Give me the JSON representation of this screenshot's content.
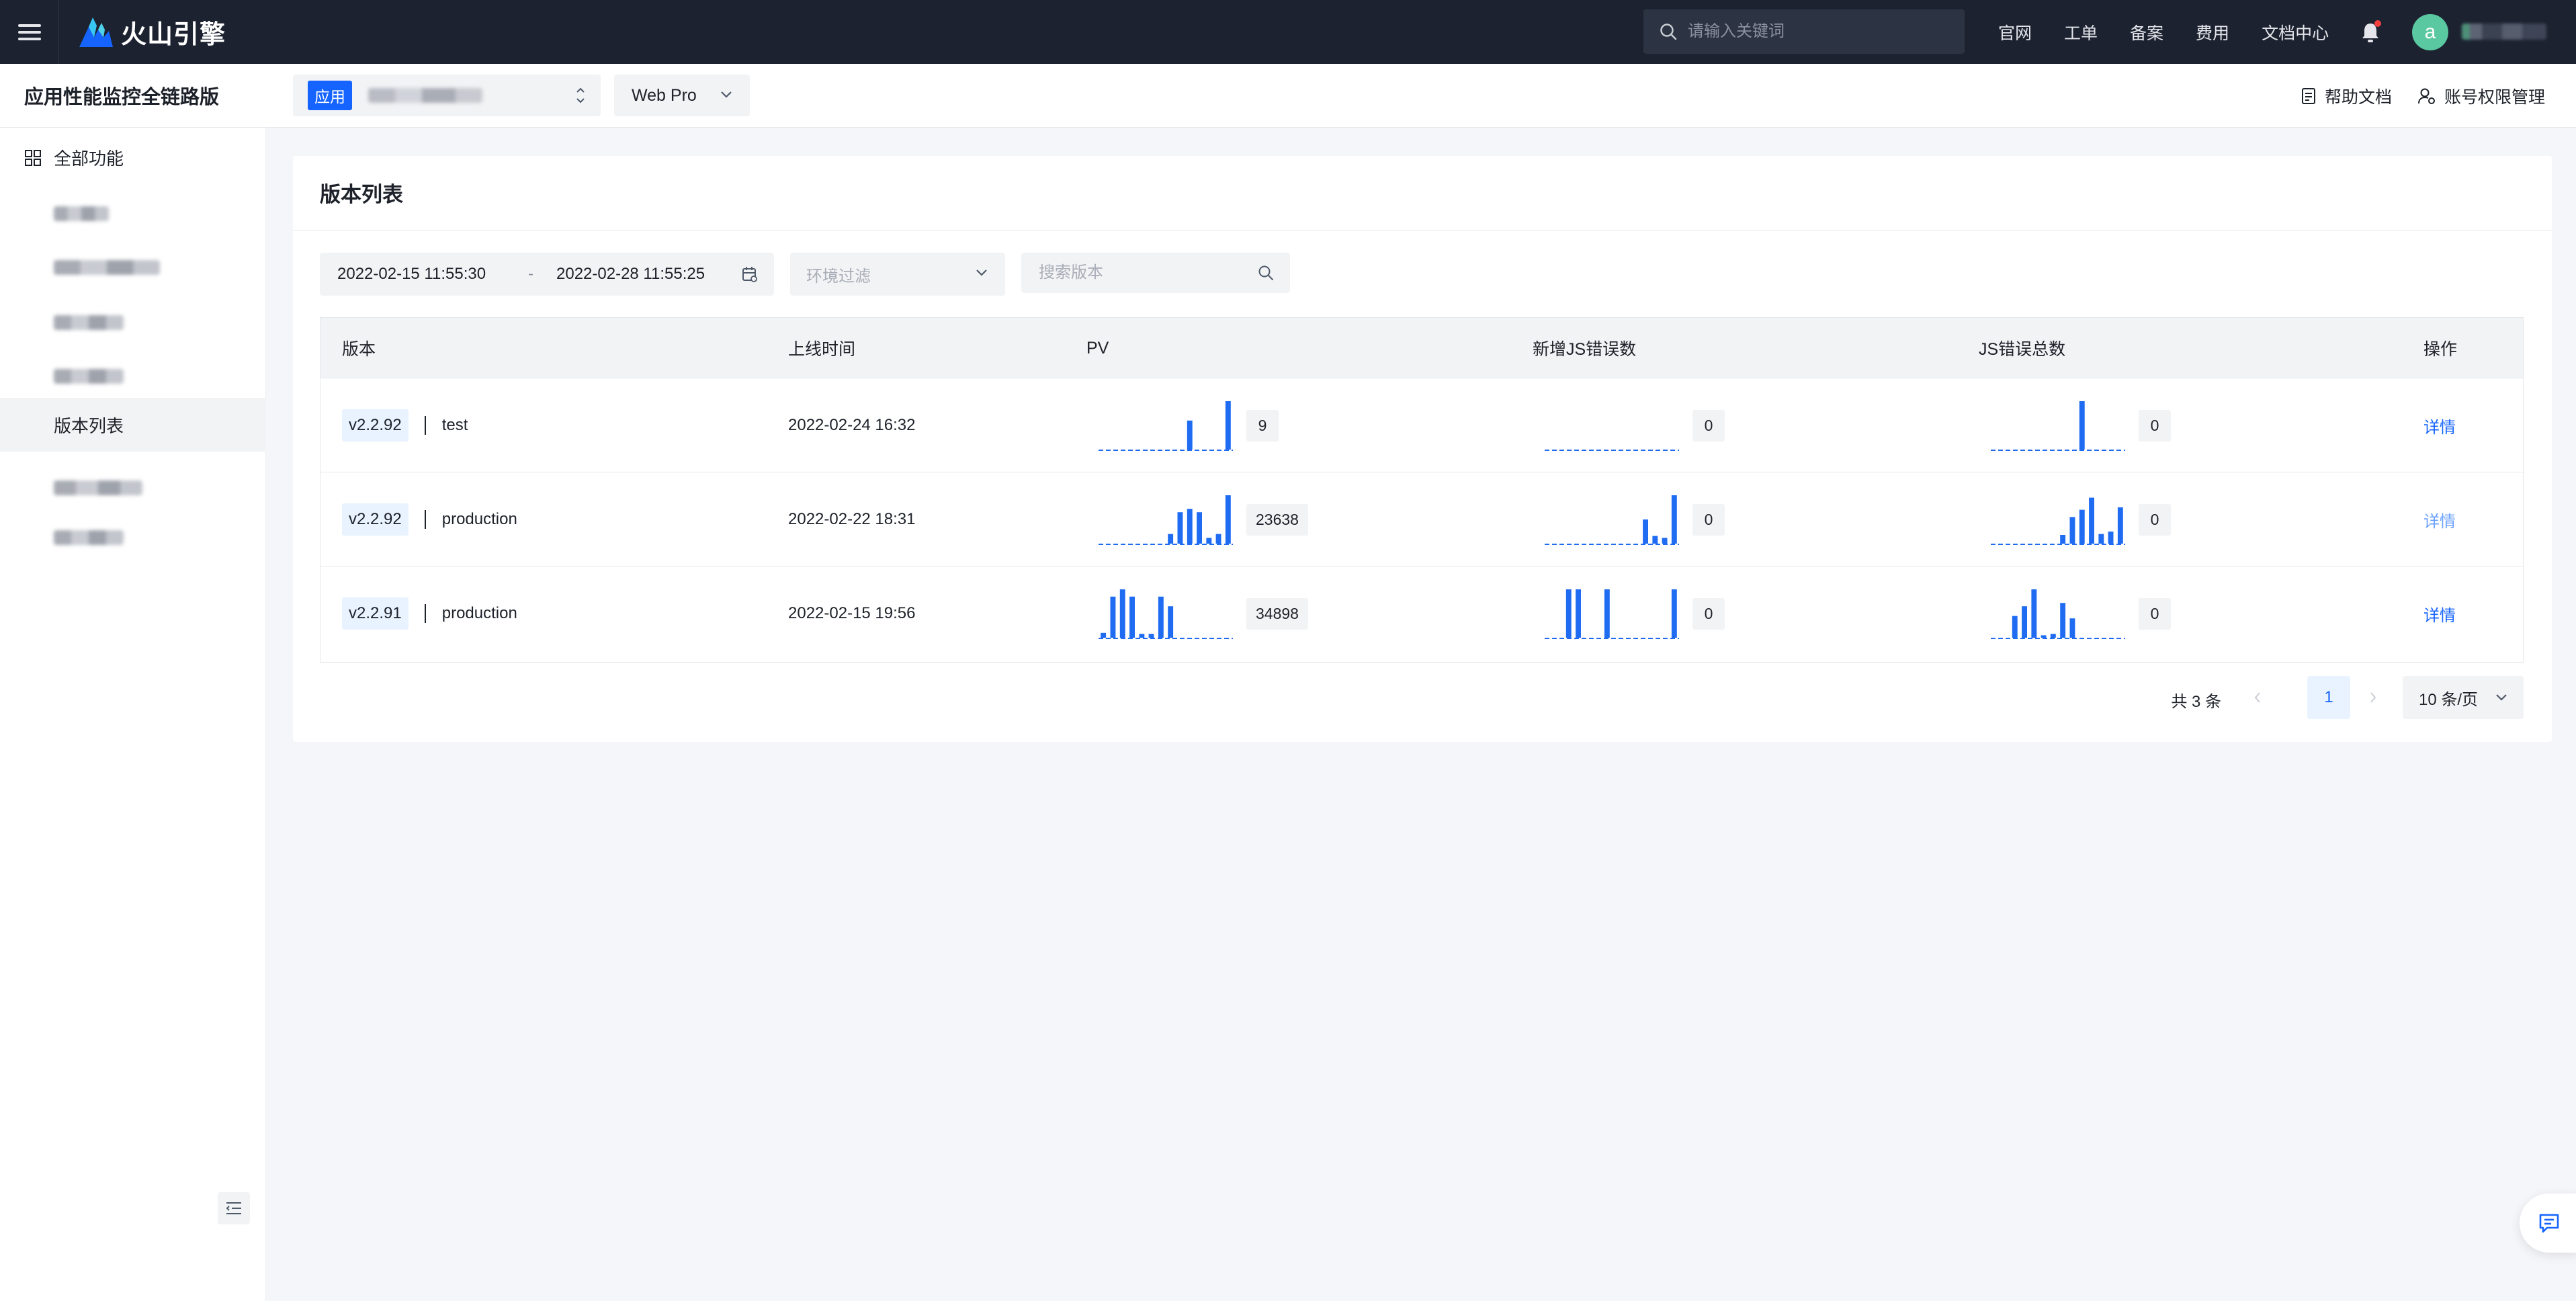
{
  "topbar": {
    "brand": "火山引擎",
    "search_placeholder": "请输入关键词",
    "links": [
      "官网",
      "工单",
      "备案",
      "费用",
      "文档中心"
    ],
    "avatar_letter": "a",
    "user_name": "redacted"
  },
  "subbar": {
    "product_title": "应用性能监控全链路版",
    "app_tag": "应用",
    "app_name": "redacted",
    "platform": "Web Pro",
    "help_docs": "帮助文档",
    "account_permissions": "账号权限管理"
  },
  "sidebar": {
    "all_functions": "全部功能",
    "active_item": "版本列表"
  },
  "main": {
    "title": "版本列表",
    "filters": {
      "date_start": "2022-02-15 11:55:30",
      "date_sep": "-",
      "date_end": "2022-02-28 11:55:25",
      "env_placeholder": "环境过滤",
      "search_placeholder": "搜索版本"
    },
    "columns": [
      "版本",
      "上线时间",
      "PV",
      "新增JS错误数",
      "JS错误总数",
      "操作"
    ],
    "rows": [
      {
        "version": "v2.2.92",
        "env": "test",
        "release_time": "2022-02-24 16:32",
        "pv": "9",
        "new_js_errors": "0",
        "total_js_errors": "0",
        "action": "详情",
        "pv_trend": [
          0,
          0,
          0,
          0,
          0,
          0,
          0,
          0,
          0,
          0.6,
          0,
          0,
          0,
          1
        ],
        "new_err_trend": [
          0,
          0,
          0,
          0,
          0,
          0,
          0,
          0,
          0,
          0,
          0,
          0,
          0,
          0
        ],
        "total_err_trend": [
          0,
          0,
          0,
          0,
          0,
          0,
          0,
          0,
          0,
          1,
          0,
          0,
          0,
          0
        ]
      },
      {
        "version": "v2.2.92",
        "env": "production",
        "release_time": "2022-02-22 18:31",
        "pv": "23638",
        "new_js_errors": "0",
        "total_js_errors": "0",
        "action": "详情",
        "pv_trend": [
          0,
          0,
          0,
          0,
          0,
          0,
          0,
          0.2,
          0.65,
          0.72,
          0.65,
          0.12,
          0.2,
          1
        ],
        "new_err_trend": [
          0,
          0,
          0,
          0,
          0,
          0,
          0,
          0,
          0,
          0,
          0.5,
          0.16,
          0.12,
          1
        ],
        "total_err_trend": [
          0,
          0,
          0,
          0,
          0,
          0,
          0,
          0.18,
          0.55,
          0.7,
          0.95,
          0.2,
          0.25,
          0.75
        ]
      },
      {
        "version": "v2.2.91",
        "env": "production",
        "release_time": "2022-02-15 19:56",
        "pv": "34898",
        "new_js_errors": "0",
        "total_js_errors": "0",
        "action": "详情",
        "pv_trend": [
          0.1,
          0.85,
          1,
          0.85,
          0.08,
          0.08,
          0.85,
          0.65,
          0,
          0,
          0,
          0,
          0,
          0
        ],
        "new_err_trend": [
          0,
          0,
          1,
          1,
          0,
          0,
          1,
          0,
          0,
          0,
          0,
          0,
          0,
          1
        ],
        "total_err_trend": [
          0,
          0,
          0.45,
          0.65,
          1,
          0.05,
          0.08,
          0.72,
          0.4,
          0,
          0,
          0,
          0,
          0
        ]
      }
    ],
    "pagination": {
      "total": "共 3 条",
      "current_page": "1",
      "page_size": "10 条/页"
    }
  },
  "colors": {
    "accent": "#1664ff",
    "topbar_bg": "#1c2230",
    "spark_bar": "#1f6cf2"
  }
}
